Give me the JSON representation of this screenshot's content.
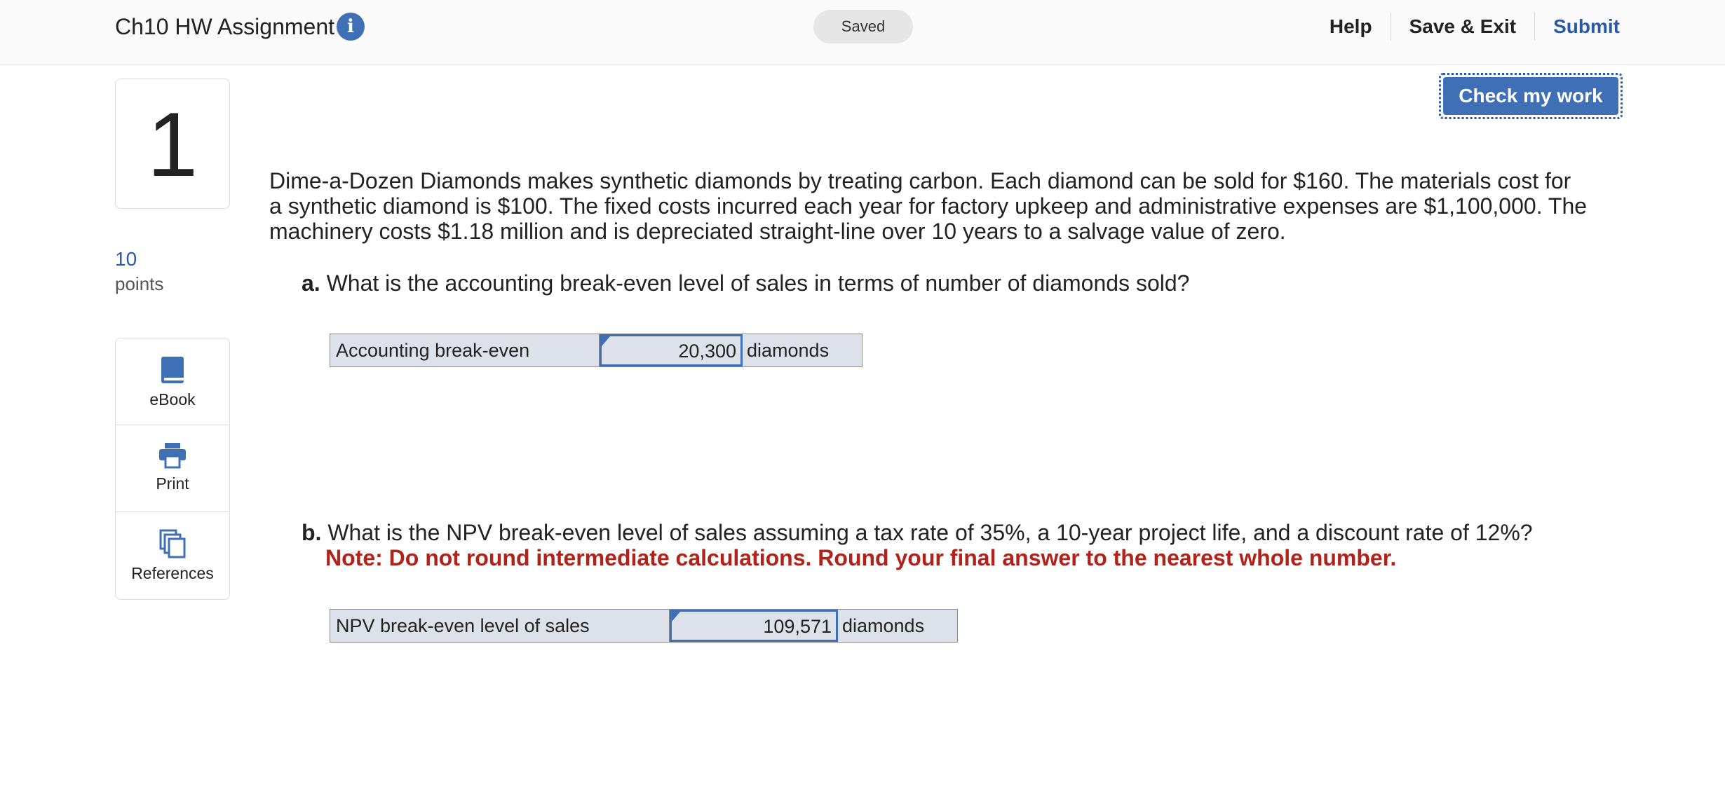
{
  "header": {
    "title": "Ch10 HW Assignment",
    "saved_status": "Saved",
    "help_label": "Help",
    "save_exit_label": "Save & Exit",
    "submit_label": "Submit"
  },
  "check_my_work_label": "Check my work",
  "question": {
    "number": "1",
    "points_value": "10",
    "points_label": "points",
    "intro": "Dime-a-Dozen Diamonds makes synthetic diamonds by treating carbon. Each diamond can be sold for $160. The materials cost for a synthetic diamond is $100. The fixed costs incurred each year for factory upkeep and administrative expenses are $1,100,000. The machinery costs $1.18 million and is depreciated straight-line over 10 years to a salvage value of zero.",
    "part_a": {
      "letter": "a.",
      "text": "What is the accounting break-even level of sales in terms of number of diamonds sold?",
      "row_label": "Accounting break-even",
      "value": "20,300",
      "unit": "diamonds"
    },
    "part_b": {
      "letter": "b.",
      "text": "What is the NPV break-even level of sales assuming a tax rate of 35%, a 10-year project life, and a discount rate of 12%?",
      "note": "Note: Do not round intermediate calculations. Round your final answer to the nearest whole number.",
      "row_label": "NPV break-even level of sales",
      "value": "109,571",
      "unit": "diamonds"
    }
  },
  "tools": {
    "ebook_label": "eBook",
    "print_label": "Print",
    "references_label": "References"
  },
  "icons": {
    "info": "info-icon",
    "ebook": "book-icon",
    "print": "printer-icon",
    "references": "documents-icon"
  },
  "colors": {
    "accent": "#3f6fb5",
    "link": "#2a5aa6",
    "note_red": "#b1221a",
    "answer_bg": "#dde1ea"
  }
}
